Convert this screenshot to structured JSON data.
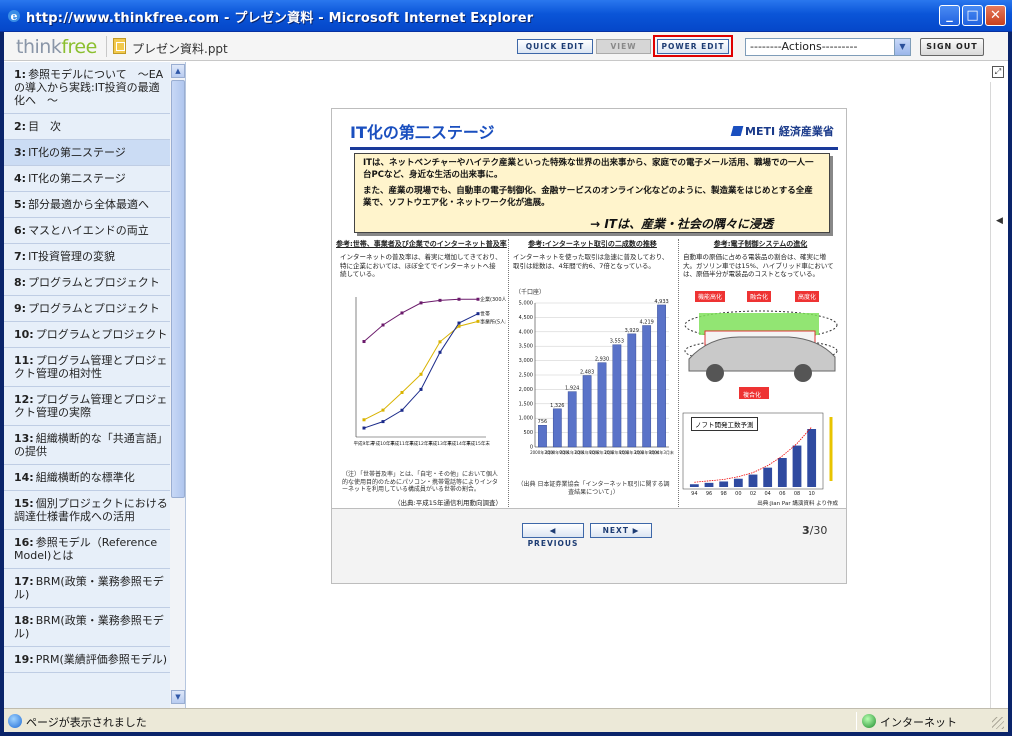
{
  "window": {
    "title": "http://www.thinkfree.com - プレゼン資料 - Microsoft Internet Explorer",
    "min": "_",
    "max": "□",
    "close": "✕"
  },
  "app": {
    "logo_think": "think",
    "logo_free": "free",
    "doc_name": "プレゼン資料.ppt",
    "quick_edit": "QUICK EDIT",
    "view": "VIEW",
    "power_edit": "POWER EDIT",
    "actions": "--------Actions---------",
    "sign_out": "SIGN OUT"
  },
  "sidebar": {
    "items": [
      {
        "num": "1:",
        "label": "参照モデルについて　～EAの導入から実践:IT投資の最適化へ　～"
      },
      {
        "num": "2:",
        "label": "目　次"
      },
      {
        "num": "3:",
        "label": "IT化の第二ステージ"
      },
      {
        "num": "4:",
        "label": "IT化の第二ステージ"
      },
      {
        "num": "5:",
        "label": "部分最適から全体最適へ"
      },
      {
        "num": "6:",
        "label": "マスとハイエンドの両立"
      },
      {
        "num": "7:",
        "label": "IT投資管理の変貌"
      },
      {
        "num": "8:",
        "label": "プログラムとプロジェクト"
      },
      {
        "num": "9:",
        "label": "プログラムとプロジェクト"
      },
      {
        "num": "10:",
        "label": "プログラムとプロジェクト"
      },
      {
        "num": "11:",
        "label": "プログラム管理とプロジェクト管理の相対性"
      },
      {
        "num": "12:",
        "label": "プログラム管理とプロジェクト管理の実際"
      },
      {
        "num": "13:",
        "label": "組織横断的な「共通言語」の提供"
      },
      {
        "num": "14:",
        "label": "組織横断的な標準化"
      },
      {
        "num": "15:",
        "label": "個別プロジェクトにおける調達仕様書作成への活用"
      },
      {
        "num": "16:",
        "label": "参照モデル（Reference Model)とは"
      },
      {
        "num": "17:",
        "label": "BRM(政策・業務参照モデル)"
      },
      {
        "num": "18:",
        "label": "BRM(政策・業務参照モデル)"
      },
      {
        "num": "19:",
        "label": "PRM(業績評価参照モデル)"
      }
    ],
    "selected_index": 2
  },
  "slide": {
    "title": "IT化の第二ステージ",
    "org": "METI 経済産業省",
    "callout_p1": "ITは、ネットベンチャーやハイテク産業といった特殊な世界の出来事から、家庭での電子メール活用、職場での一人一台PCなど、身近な生活の出来事に。",
    "callout_p2": "また、産業の現場でも、自動車の電子制御化、金融サービスのオンライン化などのように、製造業をはじめとする全産業で、ソフトウエア化・ネットワーク化が進展。",
    "callout_tag": "→ ITは、産業・社会の隅々に浸透",
    "panel1": {
      "heading": "参考:世帯、事業者及び企業でのインターネット普及率",
      "body": "インターネットの普及率は、着実に増加してきており、特に企業においては、ほぼ全てでインターネットへ接続している。",
      "note": "（注）「世帯普及率」とは、「自宅・その他」において個人的な使用目的のためにパソコン・携帯電話等によりインターネットを利用している構成員がいる世帯の割合。",
      "source": "（出典:平成15年通信利用動向調査）"
    },
    "panel2": {
      "heading": "参考:インターネット取引の二成数の推移",
      "body": "インターネットを使った取引は急速に普及しており、取引は総数は、4年間で約6、7倍となっている。",
      "unit": "（千口座）",
      "source": "（出典 日本証券業協会「インターネット取引に関する調査結果について」）"
    },
    "panel3": {
      "heading": "参考:電子制御システムの進化",
      "body": "自動車の原価に占める電装品の割合は、確実に増大。ガソリン車では15%、ハイブリッド車においては、原価半分が電装品のコストとなっている。",
      "label_a": "機能高化",
      "label_b": "融合化",
      "label_c": "高度化",
      "label_d": "複合化",
      "chart_title": "ノフト開発工数予測",
      "source": "出典:Jian Par 講演資料 より作成"
    }
  },
  "chart_data": [
    {
      "type": "line",
      "title": "",
      "x": [
        "平成9年末",
        "平成10年末",
        "平成11年末",
        "平成12年末",
        "平成13年末",
        "平成14年末",
        "平成15年末"
      ],
      "series": [
        {
          "name": "企業(300人以上)",
          "values": [
            68.2,
            80.0,
            88.6,
            95.8,
            97.6,
            98.4,
            98.4
          ]
        },
        {
          "name": "事業所(5人以上)",
          "values": [
            12.3,
            19.2,
            31.8,
            44.8,
            68.0,
            79.1,
            82.6
          ]
        },
        {
          "name": "世帯",
          "values": [
            6.4,
            11.0,
            19.1,
            34.0,
            60.5,
            81.4,
            88.1
          ]
        }
      ],
      "ylim": [
        0,
        100
      ]
    },
    {
      "type": "bar",
      "title": "",
      "ylabel": "（千口座）",
      "categories": [
        "2000年3月末",
        "2000年9月末",
        "2001年3月末",
        "2001年9月末",
        "2002年3月末",
        "2002年9月末",
        "2003年3月末",
        "2003年9月末",
        "2004年3月末"
      ],
      "values": [
        756,
        1326,
        1924,
        2483,
        2930,
        3553,
        3929,
        4219,
        4933
      ],
      "ylim": [
        0,
        5000
      ],
      "yticks": [
        0,
        500,
        1000,
        1500,
        2000,
        2500,
        3000,
        3500,
        4000,
        4500,
        5000
      ]
    },
    {
      "type": "bar",
      "title": "ノフト開発工数予測",
      "categories": [
        "94",
        "96",
        "98",
        "00",
        "02",
        "04",
        "06",
        "08",
        "10"
      ],
      "values": [
        2,
        3,
        4,
        6,
        9,
        14,
        21,
        30,
        42
      ]
    }
  ],
  "nav": {
    "prev": "◀ PREVIOUS",
    "next": "NEXT ▶",
    "page_current": "3",
    "page_total": "/30"
  },
  "status": {
    "text": "ページが表示されました",
    "zone": "インターネット"
  }
}
